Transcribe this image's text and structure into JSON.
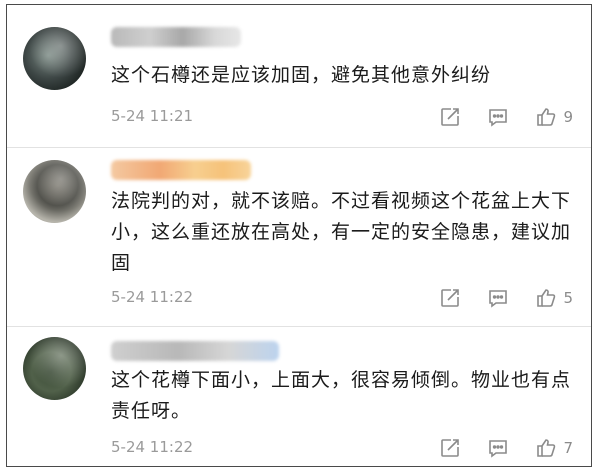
{
  "comments": [
    {
      "username": "",
      "text": "这个石樽还是应该加固，避免其他意外纠纷",
      "time": "5-24 11:21",
      "likes": "9"
    },
    {
      "username": "",
      "text": "法院判的对，就不该赔。不过看视频这个花盆上大下小，这么重还放在高处，有一定的安全隐患，建议加固",
      "time": "5-24 11:22",
      "likes": "5"
    },
    {
      "username": "",
      "text": "这个花樽下面小，上面大，很容易倾倒。物业也有点责任呀。",
      "time": "5-24 11:22",
      "likes": "7"
    }
  ]
}
